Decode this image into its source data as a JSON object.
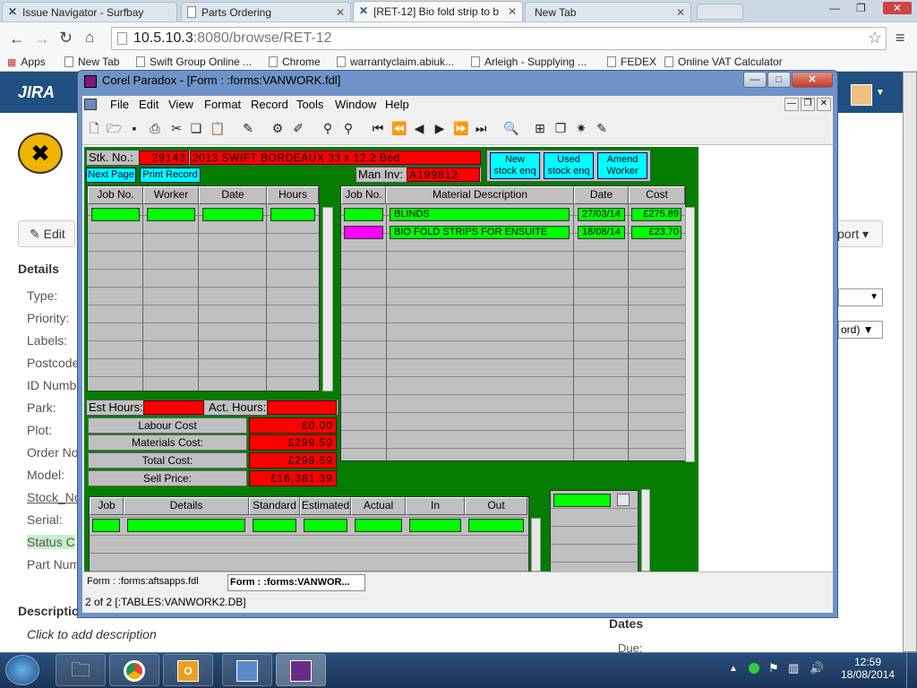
{
  "browser": {
    "tabs": [
      {
        "title": "Issue Navigator - Surfbay"
      },
      {
        "title": "Parts Ordering"
      },
      {
        "title": "[RET-12] Bio fold strip to b"
      },
      {
        "title": "New Tab"
      }
    ],
    "address": {
      "host": "10.5.10.3",
      "rest": ":8080/browse/RET-12"
    },
    "bookmarks": [
      "Apps",
      "New Tab",
      "Swift Group Online ...",
      "Chrome",
      "warrantyclaim.abiuk...",
      "Arleigh - Supplying ...",
      "FEDEX",
      "Online VAT Calculator"
    ]
  },
  "jira": {
    "logo": "JIRA",
    "edit_label": "Edit",
    "export_label": "port",
    "details_heading": "Details",
    "fields": [
      "Type:",
      "Priority:",
      "Labels:",
      "Postcode",
      "ID Numbe",
      "Park:",
      "Plot:",
      "Order No",
      "Model:",
      "Stock_No",
      "Serial:",
      "Status C",
      "Part Num"
    ],
    "dropdown_2": "ord)",
    "description_heading": "Descriptio",
    "description_placeholder": "Click to add description",
    "dates_heading": "Dates",
    "due_label": "Due:"
  },
  "paradox": {
    "title": "Corel Paradox - [Form : :forms:VANWORK.fdl]",
    "menu": [
      "File",
      "Edit",
      "View",
      "Format",
      "Record",
      "Tools",
      "Window",
      "Help"
    ],
    "form": {
      "stk_no_label": "Stk. No.:",
      "stk_no": "29143",
      "vehicle": "2013 SWIFT BORDEAUX 33 x 12.2 Bed",
      "man_inv_label": "Man Inv:",
      "man_inv": "A199812",
      "next_page": "Next Page",
      "print_record": "Print Record",
      "btn_new": [
        "New",
        "stock enq"
      ],
      "btn_used": [
        "Used",
        "stock enq"
      ],
      "btn_amend": [
        "Amend",
        "Worker"
      ],
      "labour_headers": [
        "Job No.",
        "Worker",
        "Date",
        "Hours"
      ],
      "material_headers": [
        "Job No.",
        "Material Description",
        "Date",
        "Cost"
      ],
      "materials": [
        {
          "desc": "BLINDS",
          "date": "27/03/14",
          "cost": "£275.89"
        },
        {
          "desc": "BIO FOLD STRIPS FOR ENSUITE",
          "date": "18/08/14",
          "cost": "£23.70"
        }
      ],
      "est_hours_label": "Est Hours:",
      "act_hours_label": "Act. Hours:",
      "costs": [
        {
          "label": "Labour Cost",
          "value": "£0.00"
        },
        {
          "label": "Materials Cost:",
          "value": "£299.59"
        },
        {
          "label": "Total Cost:",
          "value": "£299.59"
        },
        {
          "label": "Sell Price:",
          "value": "£16,381.39"
        }
      ],
      "job_headers": [
        "Job",
        "Details",
        "Standard",
        "Estimated",
        "Actual",
        "In",
        "Out"
      ]
    },
    "status": {
      "tab1": "Form : :forms:aftsapps.fdl",
      "tab2": "Form : :forms:VANWOR...",
      "record": "2 of 2 [:TABLES:VANWORK2.DB]"
    }
  },
  "taskbar": {
    "time": "12:59",
    "date": "18/08/2014"
  },
  "colors": {
    "form_green": "#047d00",
    "field_red": "#ff0000",
    "field_green": "#00ff00",
    "button_cyan": "#00ffff",
    "jira_blue": "#205081"
  }
}
